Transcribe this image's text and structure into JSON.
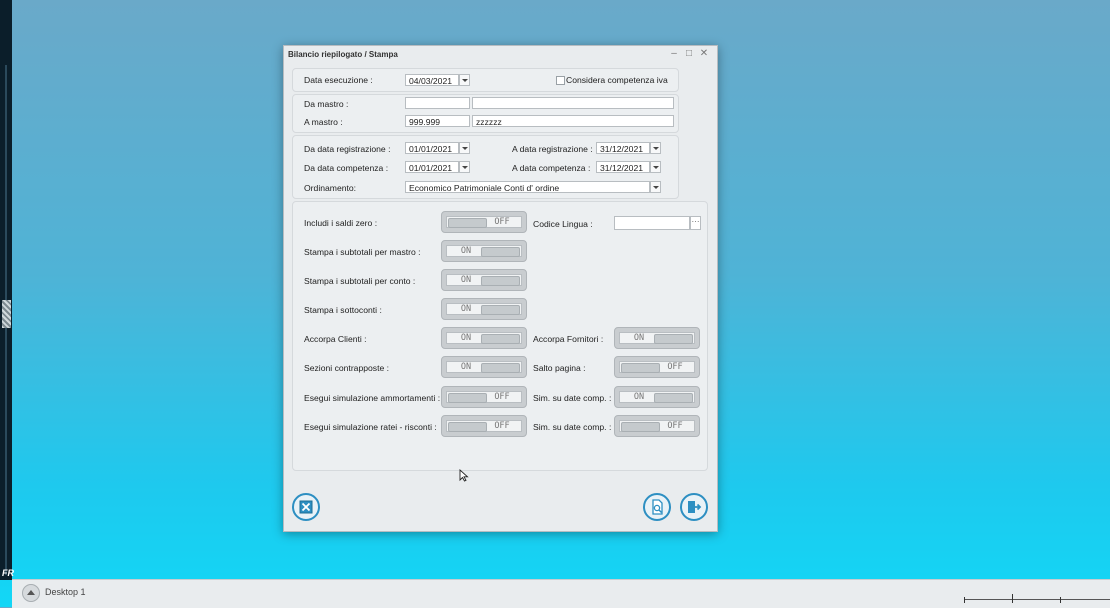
{
  "window": {
    "title": "Bilancio riepilogato / Stampa"
  },
  "execution": {
    "label": "Data esecuzione :",
    "value": "04/03/2021",
    "vat_checkbox_label": "Considera competenza iva",
    "vat_checked": false
  },
  "mastro": {
    "from_label": "Da mastro :",
    "from_code": "",
    "from_desc": "",
    "to_label": "A mastro :",
    "to_code": "999.999",
    "to_desc": "zzzzzz"
  },
  "dates": {
    "reg_from_label": "Da data registrazione :",
    "reg_from": "01/01/2021",
    "reg_to_label": "A data registrazione :",
    "reg_to": "31/12/2021",
    "comp_from_label": "Da data competenza :",
    "comp_from": "01/01/2021",
    "comp_to_label": "A data competenza :",
    "comp_to": "31/12/2021",
    "order_label": "Ordinamento:",
    "order_value": "Economico Patrimoniale Conti d' ordine"
  },
  "options": {
    "zero_balances": {
      "label": "Includi i saldi zero :",
      "state": "OFF"
    },
    "language": {
      "label": "Codice Lingua :",
      "value": ""
    },
    "subtotals_mastro": {
      "label": "Stampa i subtotali per mastro :",
      "state": "ON"
    },
    "subtotals_conto": {
      "label": "Stampa i subtotali per conto :",
      "state": "ON"
    },
    "subaccounts": {
      "label": "Stampa i sottoconti :",
      "state": "ON"
    },
    "merge_customers": {
      "label": "Accorpa Clienti :",
      "state": "ON"
    },
    "merge_suppliers": {
      "label": "Accorpa Fornitori :",
      "state": "ON"
    },
    "opposite_sections": {
      "label": "Sezioni contrapposte :",
      "state": "ON"
    },
    "page_break": {
      "label": "Salto pagina :",
      "state": "OFF"
    },
    "sim_depreciation": {
      "label": "Esegui simulazione ammortamenti :",
      "state": "OFF"
    },
    "sim_depr_dates": {
      "label": "Sim. su date comp. :",
      "state": "ON"
    },
    "sim_accruals": {
      "label": "Esegui simulazione ratei - risconti :",
      "state": "OFF"
    },
    "sim_accr_dates": {
      "label": "Sim. su date comp. :",
      "state": "OFF"
    }
  },
  "taskbar": {
    "desktop_label": "Desktop 1"
  },
  "sidebar": {
    "label": "FR"
  },
  "colors": {
    "accent": "#2d8fc2",
    "window_bg": "#e9ecee"
  }
}
